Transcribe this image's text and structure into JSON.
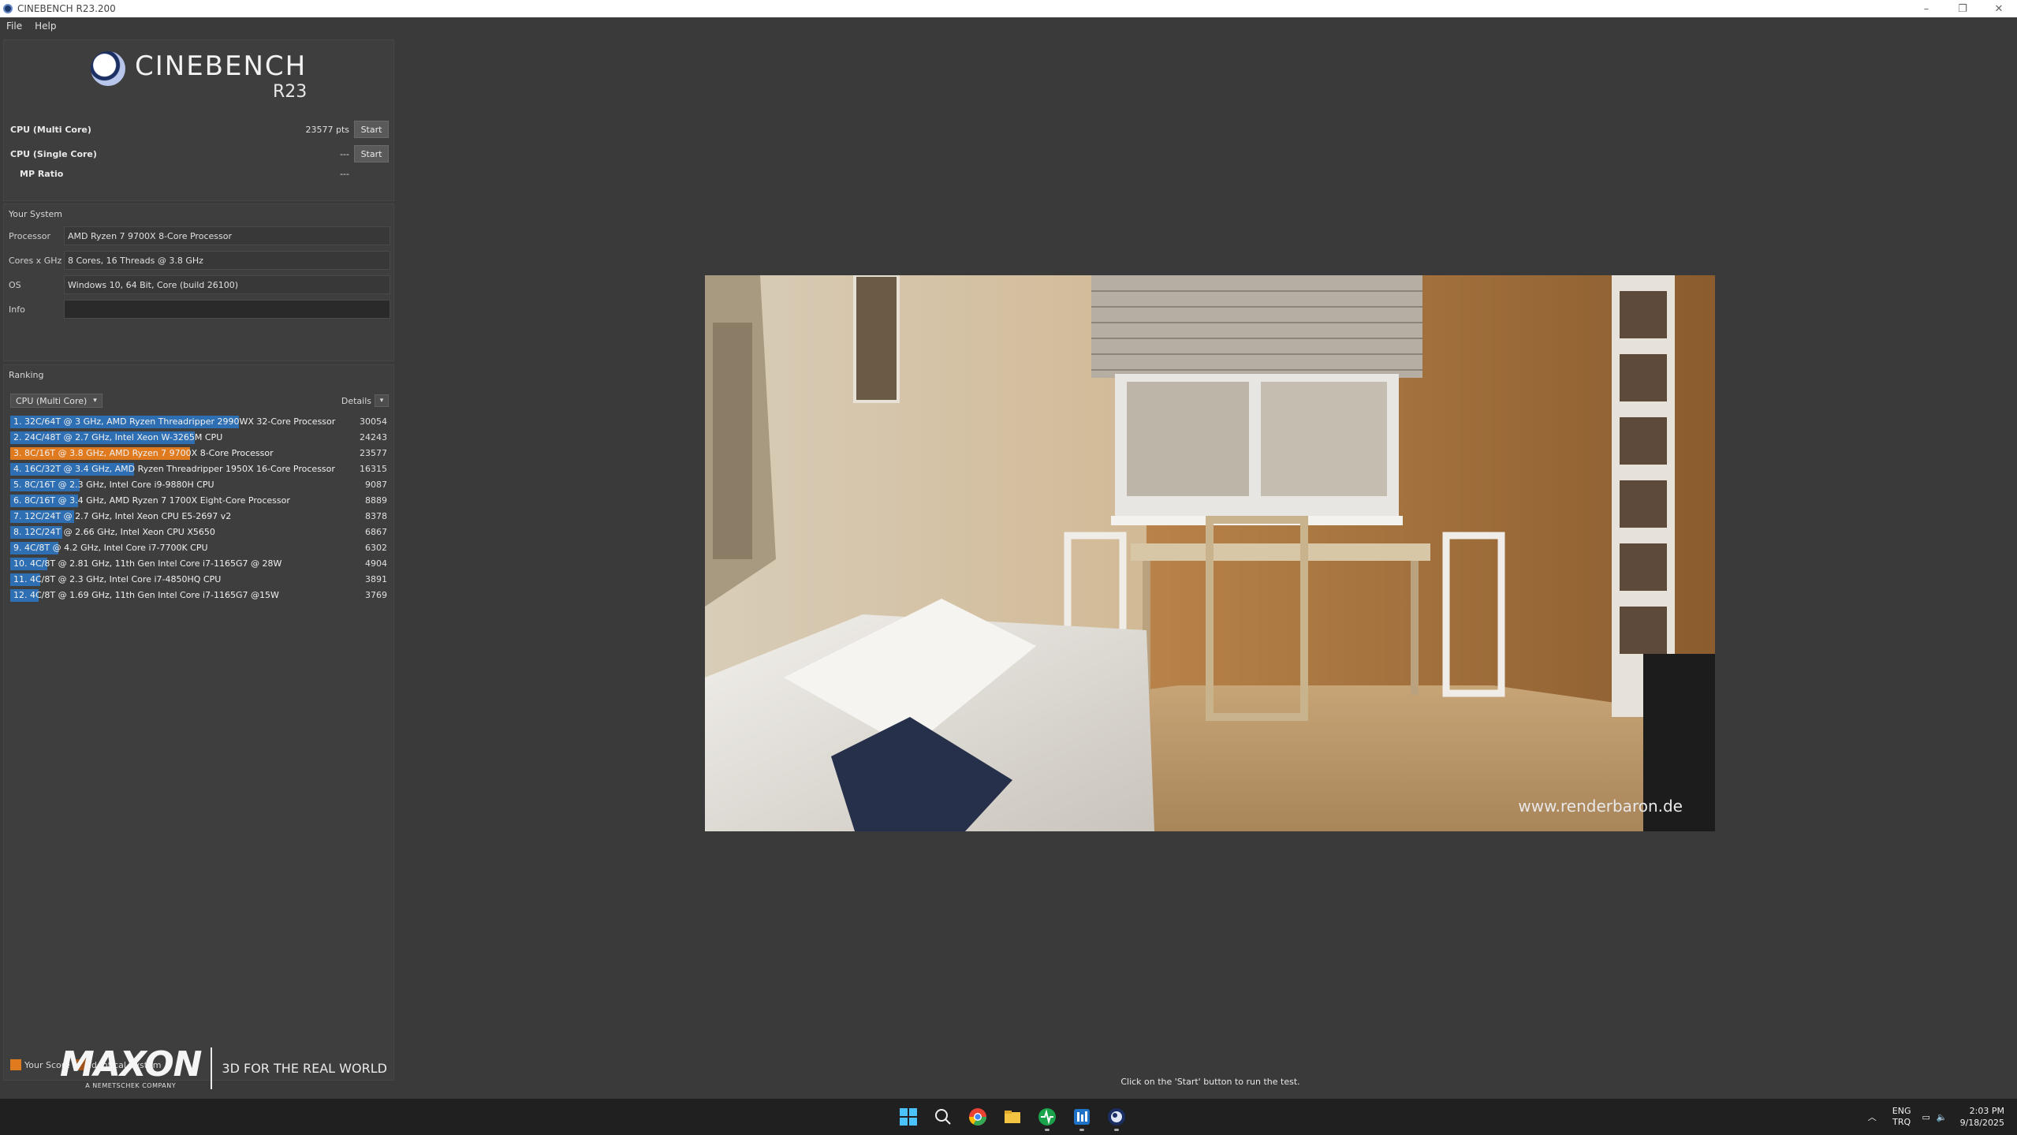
{
  "window": {
    "title": "CINEBENCH R23.200",
    "min": "–",
    "restore": "❐",
    "close": "✕"
  },
  "menu": {
    "file": "File",
    "help": "Help"
  },
  "logo": {
    "name": "CINEBENCH",
    "version": "R23"
  },
  "tests": {
    "multi": {
      "label": "CPU (Multi Core)",
      "value": "23577 pts",
      "button": "Start"
    },
    "single": {
      "label": "CPU (Single Core)",
      "value": "---",
      "button": "Start"
    },
    "mp": {
      "label": "MP Ratio",
      "value": "---"
    }
  },
  "system": {
    "title": "Your System",
    "processor": {
      "key": "Processor",
      "value": "AMD Ryzen 7 9700X 8-Core Processor"
    },
    "cores": {
      "key": "Cores x GHz",
      "value": "8 Cores, 16 Threads @ 3.8 GHz"
    },
    "os": {
      "key": "OS",
      "value": "Windows 10, 64 Bit, Core (build 26100)"
    },
    "info": {
      "key": "Info",
      "value": ""
    }
  },
  "ranking": {
    "title": "Ranking",
    "dropdown": "CPU (Multi Core)",
    "details": "Details",
    "max_score": 30054,
    "items": [
      {
        "label": "1. 32C/64T @ 3 GHz, AMD Ryzen Threadripper 2990WX 32-Core Processor",
        "score": 30054,
        "mine": false
      },
      {
        "label": "2. 24C/48T @ 2.7 GHz, Intel Xeon W-3265M CPU",
        "score": 24243,
        "mine": false
      },
      {
        "label": "3. 8C/16T @ 3.8 GHz, AMD Ryzen 7 9700X 8-Core Processor",
        "score": 23577,
        "mine": true
      },
      {
        "label": "4. 16C/32T @ 3.4 GHz, AMD Ryzen Threadripper 1950X 16-Core Processor",
        "score": 16315,
        "mine": false
      },
      {
        "label": "5. 8C/16T @ 2.3 GHz, Intel Core i9-9880H CPU",
        "score": 9087,
        "mine": false
      },
      {
        "label": "6. 8C/16T @ 3.4 GHz, AMD Ryzen 7 1700X Eight-Core Processor",
        "score": 8889,
        "mine": false
      },
      {
        "label": "7. 12C/24T @ 2.7 GHz, Intel Xeon CPU E5-2697 v2",
        "score": 8378,
        "mine": false
      },
      {
        "label": "8. 12C/24T @ 2.66 GHz, Intel Xeon CPU X5650",
        "score": 6867,
        "mine": false
      },
      {
        "label": "9. 4C/8T @ 4.2 GHz, Intel Core i7-7700K CPU",
        "score": 6302,
        "mine": false
      },
      {
        "label": "10. 4C/8T @ 2.81 GHz, 11th Gen Intel Core i7-1165G7 @ 28W",
        "score": 4904,
        "mine": false
      },
      {
        "label": "11. 4C/8T @ 2.3 GHz, Intel Core i7-4850HQ CPU",
        "score": 3891,
        "mine": false
      },
      {
        "label": "12. 4C/8T @ 1.69 GHz, 11th Gen Intel Core i7-1165G7 @15W",
        "score": 3769,
        "mine": false
      }
    ],
    "legend": {
      "your_score": "Your Score",
      "identical": "Identical System"
    }
  },
  "colors": {
    "bar": "#2e6fb3",
    "mine": "#e07a1f",
    "identical": "#a0521a"
  },
  "maxon": {
    "word": "MAXON",
    "sub": "A NEMETSCHEK COMPANY",
    "tagline": "3D FOR THE REAL WORLD"
  },
  "render": {
    "watermark": "www.renderbaron.de"
  },
  "status": "Click on the 'Start' button to run the test.",
  "taskbar": {
    "icons": [
      "windows-start-icon",
      "search-icon",
      "chrome-icon",
      "file-explorer-icon",
      "activity-icon",
      "cpu-monitor-icon",
      "cinebench-icon"
    ],
    "lang": "ENG",
    "layout": "TRQ",
    "time": "2:03 PM",
    "date": "9/18/2025"
  }
}
